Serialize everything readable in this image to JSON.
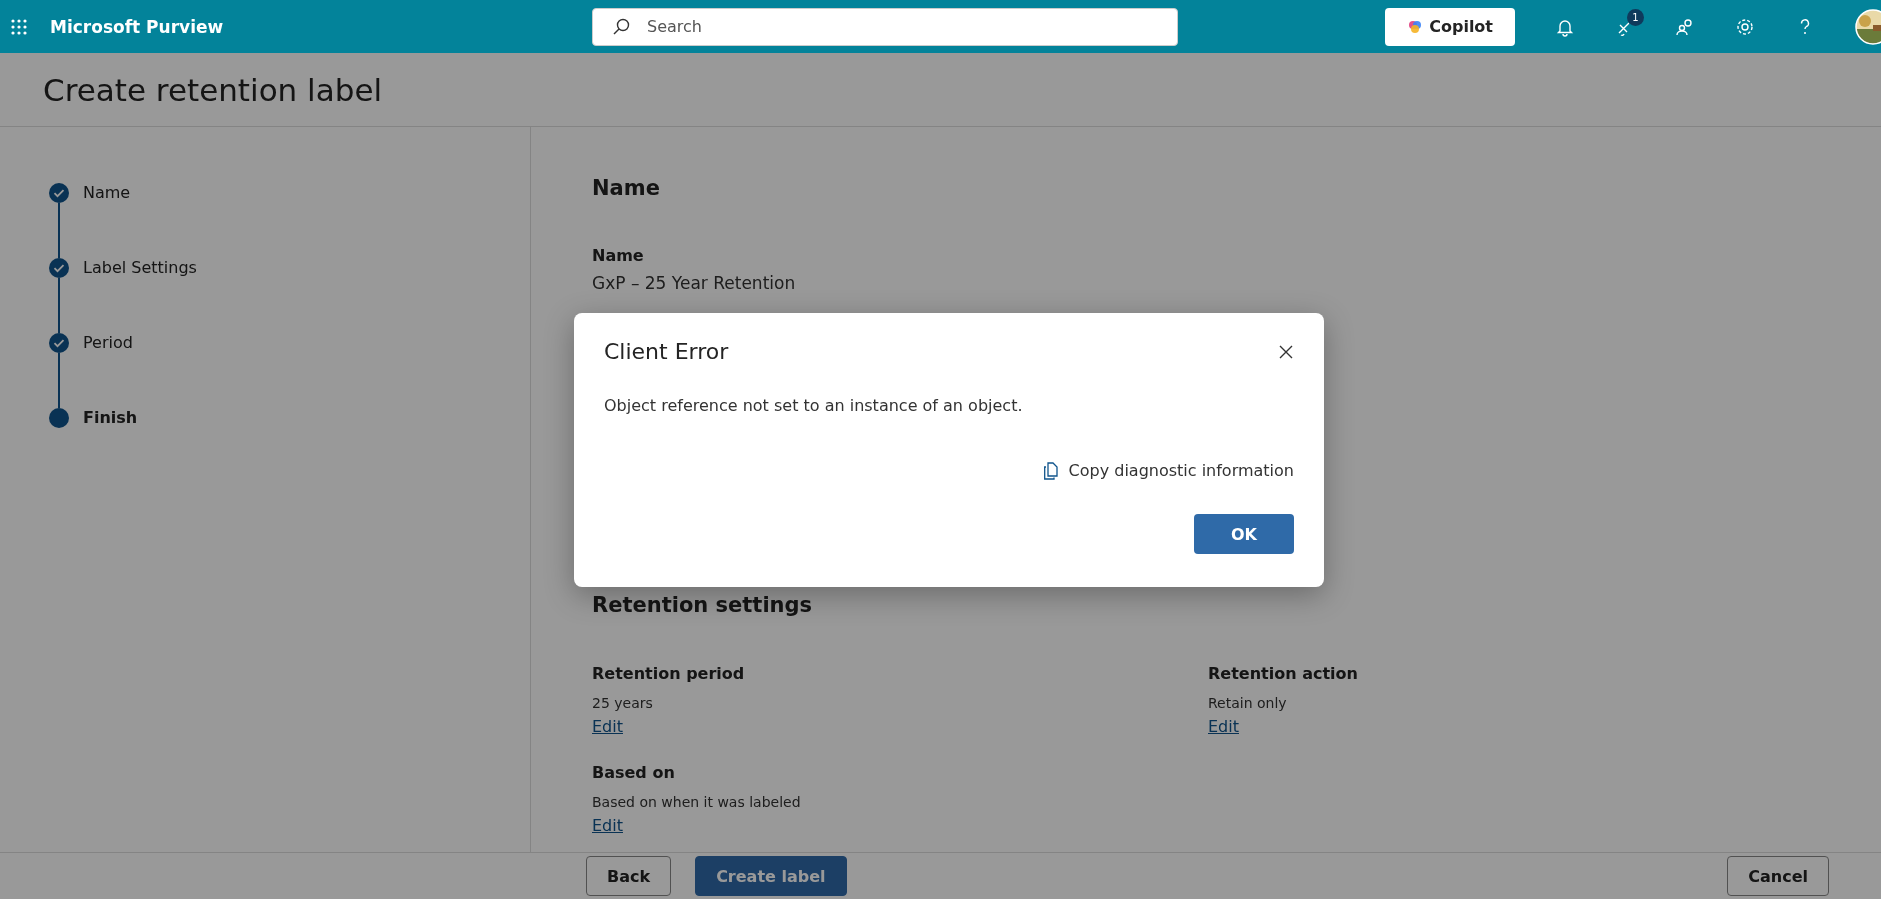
{
  "top_bar": {
    "app_name": "Microsoft Purview",
    "search": {
      "placeholder": "Search"
    },
    "copilot": "Copilot",
    "notification_count": "1"
  },
  "page": {
    "title": "Create retention label"
  },
  "steps": [
    {
      "label": "Name",
      "completed": true,
      "selected": false
    },
    {
      "label": "Label Settings",
      "completed": true,
      "selected": false
    },
    {
      "label": "Period",
      "completed": true,
      "selected": false
    },
    {
      "label": "Finish",
      "completed": false,
      "selected": true
    }
  ],
  "summary": {
    "name_section": {
      "heading": "Name",
      "field_label": "Name",
      "value": "GxP – 25 Year Retention"
    },
    "retention_section": {
      "heading": "Retention settings",
      "fields": [
        {
          "label": "Retention period",
          "value": "25 years",
          "edit": "Edit"
        },
        {
          "label": "Retention action",
          "value": "Retain only",
          "edit": "Edit"
        },
        {
          "label": "Based on",
          "value": "Based on when it was labeled",
          "edit": "Edit"
        }
      ]
    }
  },
  "footer": {
    "back": "Back",
    "create": "Create label",
    "cancel": "Cancel"
  },
  "dialog": {
    "title": "Client Error",
    "message": "Object reference not set to an instance of an object.",
    "copy_link": "Copy diagnostic information",
    "ok": "OK"
  }
}
